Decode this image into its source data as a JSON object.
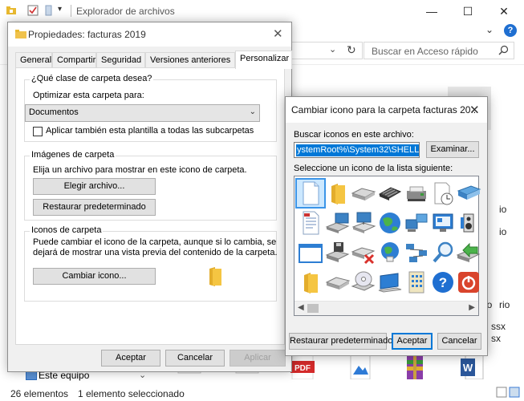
{
  "explorer": {
    "window_title": "Explorador de archivos",
    "search_placeholder": "Buscar en Acceso rápido",
    "nav_item": "Este equipo",
    "status_count": "26 elementos",
    "status_selected": "1 elemento seleccionado",
    "right_peek": [
      "io",
      "io",
      "rio",
      "rio",
      "ssx",
      "sx"
    ],
    "file_types": [
      "pdf",
      "image",
      "archive",
      "word"
    ],
    "pdf_label": "PDF",
    "word_letter": "W"
  },
  "props": {
    "title": "Propiedades: facturas 2019",
    "tabs": [
      "General",
      "Compartir",
      "Seguridad",
      "Versiones anteriores",
      "Personalizar"
    ],
    "active_tab": 4,
    "group1_title": "¿Qué clase de carpeta desea?",
    "optimize_label": "Optimizar esta carpeta para:",
    "optimize_value": "Documentos",
    "apply_subfolders_label": "Aplicar también esta plantilla a todas las subcarpetas",
    "apply_subfolders_checked": false,
    "group2_title": "Imágenes de carpeta",
    "group2_desc": "Elija un archivo para mostrar en este icono de carpeta.",
    "choose_file_btn": "Elegir archivo...",
    "restore_default_btn": "Restaurar predeterminado",
    "group3_title": "Iconos de carpeta",
    "group3_desc1": "Puede cambiar el icono de la carpeta, aunque si lo cambia, se",
    "group3_desc2": "dejará de mostrar una vista previa del contenido de la carpeta.",
    "change_icon_btn": "Cambiar icono...",
    "accept_btn": "Aceptar",
    "cancel_btn": "Cancelar",
    "apply_btn": "Aplicar"
  },
  "change_icon": {
    "title": "Cambiar icono para la carpeta facturas 20...",
    "search_label": "Buscar iconos en este archivo:",
    "path_value": "ystemRoot%\\System32\\SHELL32.dll",
    "browse_btn": "Examinar...",
    "list_label": "Seleccione un icono de la lista siguiente:",
    "icons": [
      [
        "blank-document-icon",
        "folder-icon",
        "drive-icon",
        "chip-icon",
        "printer-icon",
        "clock-document-icon",
        "scanner-icon"
      ],
      [
        "text-document-icon",
        "window-drive-icon",
        "network-computer-icon",
        "globe-icon",
        "network-computers-icon",
        "monitor-app-icon",
        "speaker-icon"
      ],
      [
        "window-icon",
        "floppy-icon",
        "delete-drive-icon",
        "globe-network-icon",
        "network-icon",
        "search-icon",
        "arrow-drive-icon"
      ],
      [
        "folder-icon",
        "hard-drive-icon",
        "cd-drive-icon",
        "computer-icon",
        "keypad-icon",
        "help-icon",
        "power-icon"
      ]
    ],
    "selected_index": 0,
    "restore_btn": "Restaurar predeterminados",
    "accept_btn": "Aceptar",
    "cancel_btn": "Cancelar"
  },
  "colors": {
    "accent": "#0078d7",
    "folder": "#f5c542",
    "help_blue": "#1f6fd1",
    "power_red": "#d9442c",
    "pdf_red": "#d42b2b"
  }
}
